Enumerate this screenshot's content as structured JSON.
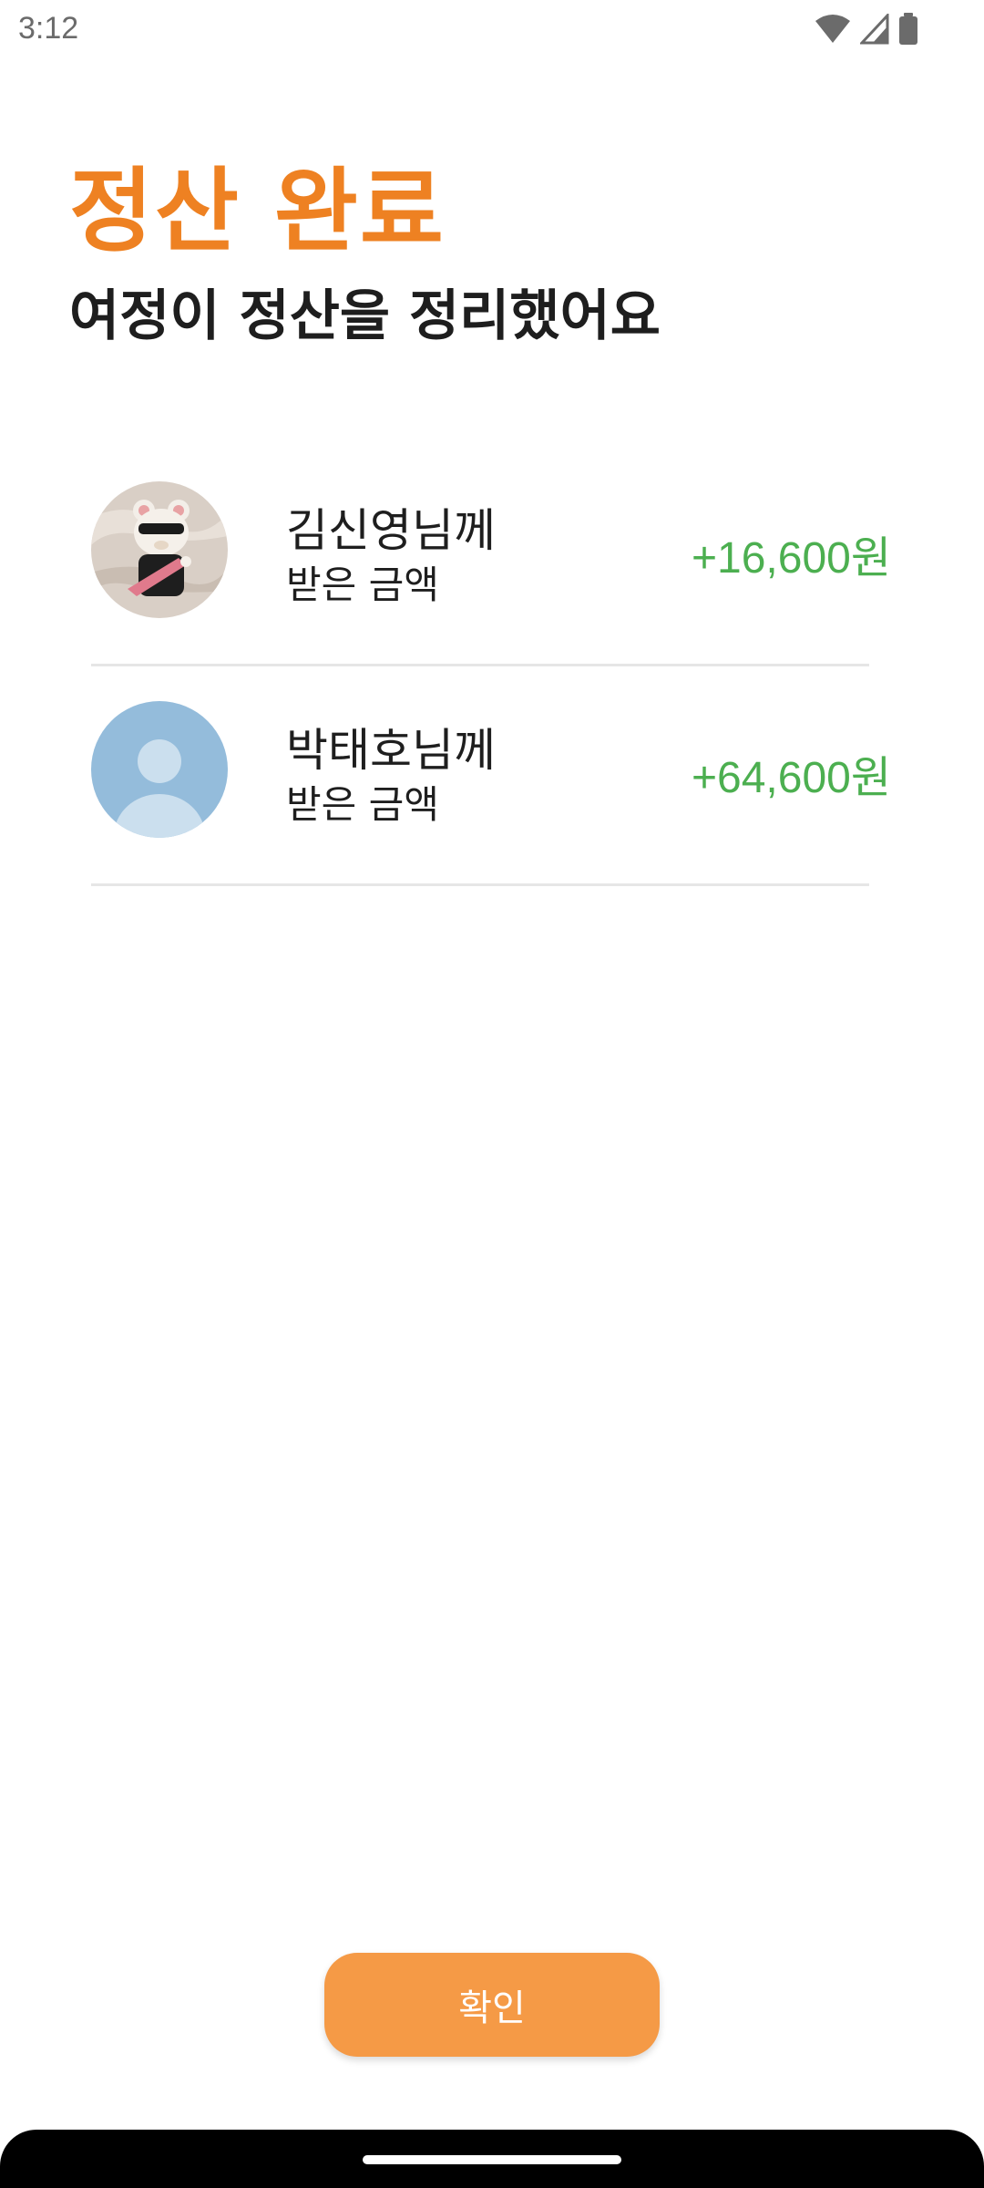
{
  "status_bar": {
    "time": "3:12",
    "icons": [
      "wifi-icon",
      "signal-icon",
      "battery-icon"
    ]
  },
  "header": {
    "title": "정산 완료",
    "subtitle": "여정이 정산을 정리했어요"
  },
  "settlements": [
    {
      "name": "김신영님께",
      "label": "받은 금액",
      "amount": "+16,600원",
      "avatar": "bear-photo-avatar"
    },
    {
      "name": "박태호님께",
      "label": "받은 금액",
      "amount": "+64,600원",
      "avatar": "default-person-avatar"
    }
  ],
  "confirm_button": {
    "label": "확인"
  },
  "colors": {
    "accent": "#ee8122",
    "button": "#f59a46",
    "positive_amount": "#4caf50"
  }
}
